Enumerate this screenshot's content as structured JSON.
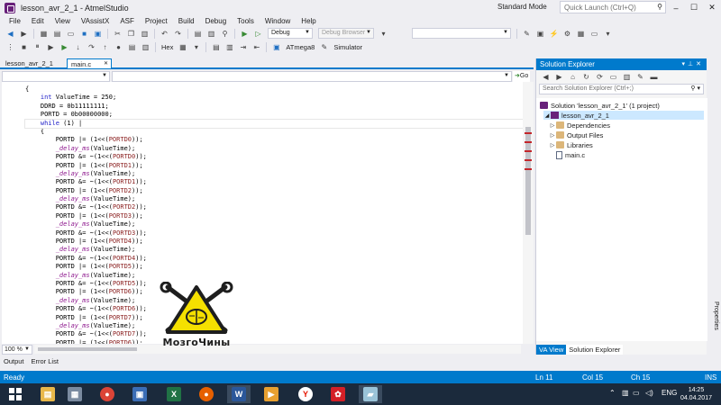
{
  "window": {
    "title": "lesson_avr_2_1 - AtmelStudio",
    "mode": "Standard Mode",
    "quick_launch_placeholder": "Quick Launch (Ctrl+Q)"
  },
  "menu": [
    "File",
    "Edit",
    "View",
    "VAssistX",
    "ASF",
    "Project",
    "Build",
    "Debug",
    "Tools",
    "Window",
    "Help"
  ],
  "toolbar": {
    "config": "Debug",
    "debug_browser": "Debug Browser",
    "hex_label": "Hex",
    "device": "ATmega8",
    "tool": "Simulator"
  },
  "tabs": [
    {
      "label": "lesson_avr_2_1",
      "active": false
    },
    {
      "label": "main.c",
      "active": true
    }
  ],
  "nav": {
    "go_label": "Go"
  },
  "code_lines": [
    [
      [
        "",
        "{"
      ]
    ],
    [
      [
        "",
        "    "
      ],
      [
        "kw",
        "int"
      ],
      [
        "",
        " ValueTime = 250;"
      ]
    ],
    [
      [
        "",
        "    DDRD = 0b11111111;"
      ]
    ],
    [
      [
        "",
        "    PORTD = 0b00000000;"
      ]
    ],
    [
      [
        "",
        "    "
      ],
      [
        "kw",
        "while"
      ],
      [
        "",
        " (1) |"
      ]
    ],
    [
      [
        "",
        "    {"
      ]
    ],
    [
      [
        "",
        "        PORTD |= (1<<("
      ],
      [
        "id",
        "PORTD0"
      ],
      [
        "",
        "));"
      ]
    ],
    [
      [
        "",
        "        "
      ],
      [
        "fn",
        "_delay_ms"
      ],
      [
        "",
        "(ValueTime);"
      ]
    ],
    [
      [
        "",
        "        PORTD &= ~(1<<("
      ],
      [
        "id",
        "PORTD0"
      ],
      [
        "",
        "));"
      ]
    ],
    [
      [
        "",
        "        PORTD |= (1<<("
      ],
      [
        "id",
        "PORTD1"
      ],
      [
        "",
        "));"
      ]
    ],
    [
      [
        "",
        "        "
      ],
      [
        "fn",
        "_delay_ms"
      ],
      [
        "",
        "(ValueTime);"
      ]
    ],
    [
      [
        "",
        "        PORTD &= ~(1<<("
      ],
      [
        "id",
        "PORTD1"
      ],
      [
        "",
        "));"
      ]
    ],
    [
      [
        "",
        "        PORTD |= (1<<("
      ],
      [
        "id",
        "PORTD2"
      ],
      [
        "",
        "));"
      ]
    ],
    [
      [
        "",
        "        "
      ],
      [
        "fn",
        "_delay_ms"
      ],
      [
        "",
        "(ValueTime);"
      ]
    ],
    [
      [
        "",
        "        PORTD &= ~(1<<("
      ],
      [
        "id",
        "PORTD2"
      ],
      [
        "",
        "));"
      ]
    ],
    [
      [
        "",
        "        PORTD |= (1<<("
      ],
      [
        "id",
        "PORTD3"
      ],
      [
        "",
        "));"
      ]
    ],
    [
      [
        "",
        "        "
      ],
      [
        "fn",
        "_delay_ms"
      ],
      [
        "",
        "(ValueTime);"
      ]
    ],
    [
      [
        "",
        "        PORTD &= ~(1<<("
      ],
      [
        "id",
        "PORTD3"
      ],
      [
        "",
        "));"
      ]
    ],
    [
      [
        "",
        "        PORTD |= (1<<("
      ],
      [
        "id",
        "PORTD4"
      ],
      [
        "",
        "));"
      ]
    ],
    [
      [
        "",
        "        "
      ],
      [
        "fn",
        "_delay_ms"
      ],
      [
        "",
        "(ValueTime);"
      ]
    ],
    [
      [
        "",
        "        PORTD &= ~(1<<("
      ],
      [
        "id",
        "PORTD4"
      ],
      [
        "",
        "));"
      ]
    ],
    [
      [
        "",
        "        PORTD |= (1<<("
      ],
      [
        "id",
        "PORTD5"
      ],
      [
        "",
        "));"
      ]
    ],
    [
      [
        "",
        "        "
      ],
      [
        "fn",
        "_delay_ms"
      ],
      [
        "",
        "(ValueTime);"
      ]
    ],
    [
      [
        "",
        "        PORTD &= ~(1<<("
      ],
      [
        "id",
        "PORTD5"
      ],
      [
        "",
        "));"
      ]
    ],
    [
      [
        "",
        "        PORTD |= (1<<("
      ],
      [
        "id",
        "PORTD6"
      ],
      [
        "",
        "));"
      ]
    ],
    [
      [
        "",
        "        "
      ],
      [
        "fn",
        "_delay_ms"
      ],
      [
        "",
        "(ValueTime);"
      ]
    ],
    [
      [
        "",
        "        PORTD &= ~(1<<("
      ],
      [
        "id",
        "PORTD6"
      ],
      [
        "",
        "));"
      ]
    ],
    [
      [
        "",
        "        PORTD |= (1<<("
      ],
      [
        "id",
        "PORTD7"
      ],
      [
        "",
        "));"
      ]
    ],
    [
      [
        "",
        "        "
      ],
      [
        "fn",
        "_delay_ms"
      ],
      [
        "",
        "(ValueTime);"
      ]
    ],
    [
      [
        "",
        "        PORTD &= ~(1<<("
      ],
      [
        "id",
        "PORTD7"
      ],
      [
        "",
        "));"
      ]
    ],
    [
      [
        "",
        "        PORTD |= (1<<("
      ],
      [
        "id",
        "PORTD6"
      ],
      [
        "",
        "));"
      ]
    ]
  ],
  "zoom": "100 %",
  "logo_text": "МозгоЧины",
  "solution_explorer": {
    "title": "Solution Explorer",
    "search_placeholder": "Search Solution Explorer (Ctrl+;)",
    "solution": "Solution 'lesson_avr_2_1' (1 project)",
    "project": "lesson_avr_2_1",
    "items": [
      "Dependencies",
      "Output Files",
      "Libraries",
      "main.c"
    ],
    "tabs": [
      "VA View",
      "Solution Explorer"
    ]
  },
  "side_strip": "Properties",
  "output_tabs": [
    "Output",
    "Error List"
  ],
  "status": {
    "ready": "Ready",
    "ln": "Ln 11",
    "col": "Col 15",
    "ch": "Ch 15",
    "ins": "INS"
  },
  "taskbar": {
    "lang": "ENG",
    "time": "14:25",
    "date": "04.04.2017"
  }
}
